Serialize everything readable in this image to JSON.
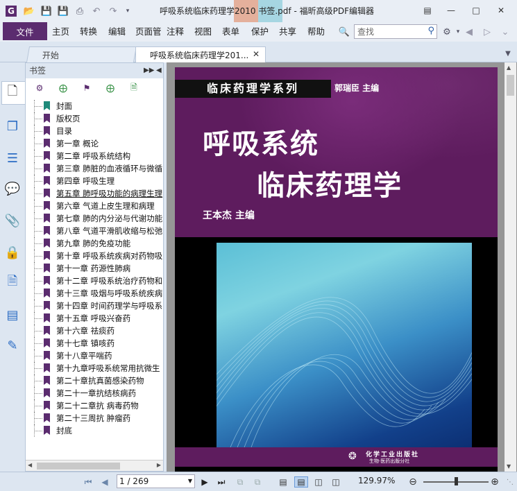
{
  "app": {
    "title": "呼吸系统临床药理学2010 书签.pdf - 福昕高级PDF编辑器",
    "logo_letter": "G"
  },
  "menu": {
    "file": "文件",
    "items": [
      "主页",
      "转换",
      "编辑",
      "页面管",
      "注释",
      "视图",
      "表单",
      "保护",
      "共享",
      "帮助"
    ]
  },
  "search": {
    "placeholder": "查找"
  },
  "tabs": [
    {
      "label": "开始"
    },
    {
      "label": "呼吸系统临床药理学201..."
    }
  ],
  "bookmarks": {
    "header": "书签",
    "items": [
      "封面",
      "版权页",
      "目录",
      "第一章 概论",
      "第二章 呼吸系统结构",
      "第三章 肺脏的血液循环与微循",
      "第四章 呼吸生理",
      "第五章 肺呼吸功能的病理生理",
      "第六章 气道上皮生理和病理",
      "第七章 肺的内分泌与代谢功能",
      "第八章 气道平滑肌收缩与松弛",
      "第九章 肺的免疫功能",
      "第十章 呼吸系统疾病对药物吸",
      "第十一章 药源性肺病",
      "第十二章 呼吸系统治疗药物和",
      "第十三章 吸烟与呼吸系统疾病",
      "第十四章 时间药理学与呼吸系",
      "第十五章 呼吸兴奋药",
      "第十六章 祛痰药",
      "第十七章 镇咳药",
      "第十八章平喘药",
      "第十九章呼吸系统常用抗微生",
      "第二十章抗真菌感染药物",
      "第二十一章抗结核病药",
      "第二十二章抗 病毒药物",
      "第二十三周抗 肿瘤药",
      "封底"
    ]
  },
  "cover": {
    "series": "临床药理学系列",
    "series_editor": "郭瑞臣  主编",
    "title_line1": "呼吸系统",
    "title_line2": "临床药理学",
    "author": "王本杰  主编",
    "publisher": "化学工业出版社",
    "publisher_sub": "生物·医药出版分社"
  },
  "status": {
    "page": "1 / 269",
    "zoom": "129.97%"
  },
  "colors": {
    "brand": "#5b2c6f",
    "cover_purple": "#5e1c5e",
    "accent_blue": "#2b6cc4"
  }
}
